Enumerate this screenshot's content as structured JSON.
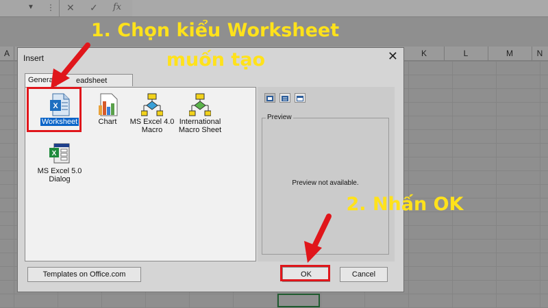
{
  "formula_bar": {
    "dropdown_icon": "chevron-down-icon",
    "cancel_icon": "x-icon",
    "confirm_icon": "check-icon",
    "function_label": "fx"
  },
  "columns": [
    {
      "id": "a",
      "label": "A"
    },
    {
      "id": "k",
      "label": "K"
    },
    {
      "id": "l",
      "label": "L"
    },
    {
      "id": "m",
      "label": "M"
    },
    {
      "id": "n",
      "label": "N"
    }
  ],
  "dialog": {
    "title": "Insert",
    "close_label": "✕",
    "tabs": [
      {
        "label": "General"
      },
      {
        "label": "Spreadsheet Solutions",
        "visible_label": "eadsheet Solutions"
      }
    ],
    "items": [
      {
        "label": "Worksheet",
        "icon": "excel-worksheet-icon",
        "selected": true
      },
      {
        "label": "Chart",
        "icon": "chart-icon"
      },
      {
        "label_line1": "MS Excel 4.0",
        "label_line2": "Macro",
        "icon": "macro-icon"
      },
      {
        "label_line1": "International",
        "label_line2": "Macro Sheet",
        "icon": "intl-macro-icon"
      },
      {
        "label_line1": "MS Excel 5.0",
        "label_line2": "Dialog",
        "icon": "dialog-icon"
      }
    ],
    "view_buttons": [
      "large-icons-view-icon",
      "list-view-icon",
      "details-view-icon"
    ],
    "preview": {
      "legend": "Preview",
      "message": "Preview not available."
    },
    "templates_button": "Templates on Office.com",
    "ok_button": "OK",
    "cancel_button": "Cancel"
  },
  "annotations": {
    "step1_line1": "1. Chọn kiểu Worksheet",
    "step1_line2": "muốn tạo",
    "step2": "2. Nhấn OK",
    "accent_color": "#ffe21b",
    "highlight_color": "#e0161b"
  }
}
